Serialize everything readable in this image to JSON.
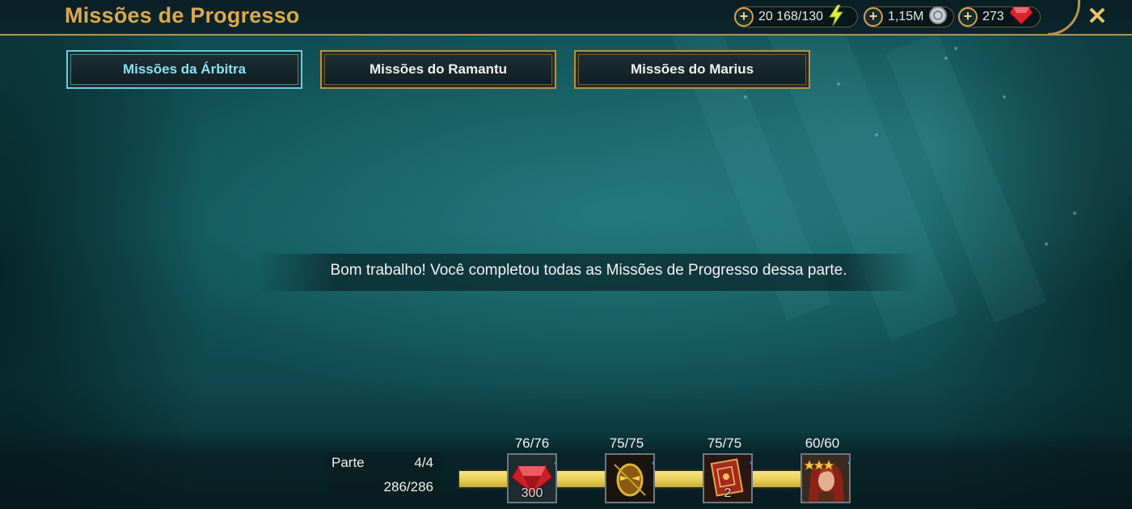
{
  "header": {
    "title": "Missões de Progresso",
    "resources": [
      {
        "id": "energy",
        "value": "20 168/130",
        "icon": "energy-lightning-icon"
      },
      {
        "id": "silver",
        "value": "1,15M",
        "icon": "silver-coin-icon"
      },
      {
        "id": "gems",
        "value": "273",
        "icon": "ruby-gem-icon"
      }
    ],
    "plus_label": "+",
    "close_label": "✕"
  },
  "tabs": [
    {
      "label": "Missões da Árbitra",
      "active": true
    },
    {
      "label": "Missões do Ramantu",
      "active": false
    },
    {
      "label": "Missões do Marius",
      "active": false
    }
  ],
  "main": {
    "message": "Bom trabalho! Você completou todas as Missões de Progresso dessa parte."
  },
  "progress": {
    "part_label": "Parte",
    "part_value": "4/4",
    "points": "286/286",
    "fill_fraction": 1.0,
    "colors": {
      "fill": "#e8cf55",
      "accent_gold": "#d9a94f",
      "active_tab": "#5fd0dc",
      "check": "#4fc3f7"
    },
    "milestones": [
      {
        "count": "76/76",
        "reward": "ruby-gem-icon",
        "quantity": "300",
        "completed": true
      },
      {
        "count": "75/75",
        "reward": "golden-mask-icon",
        "quantity": "",
        "completed": true
      },
      {
        "count": "75/75",
        "reward": "red-tome-icon",
        "quantity": "2",
        "completed": true
      },
      {
        "count": "60/60",
        "reward": "champion-portrait-icon",
        "quantity": "",
        "completed": true
      }
    ]
  }
}
